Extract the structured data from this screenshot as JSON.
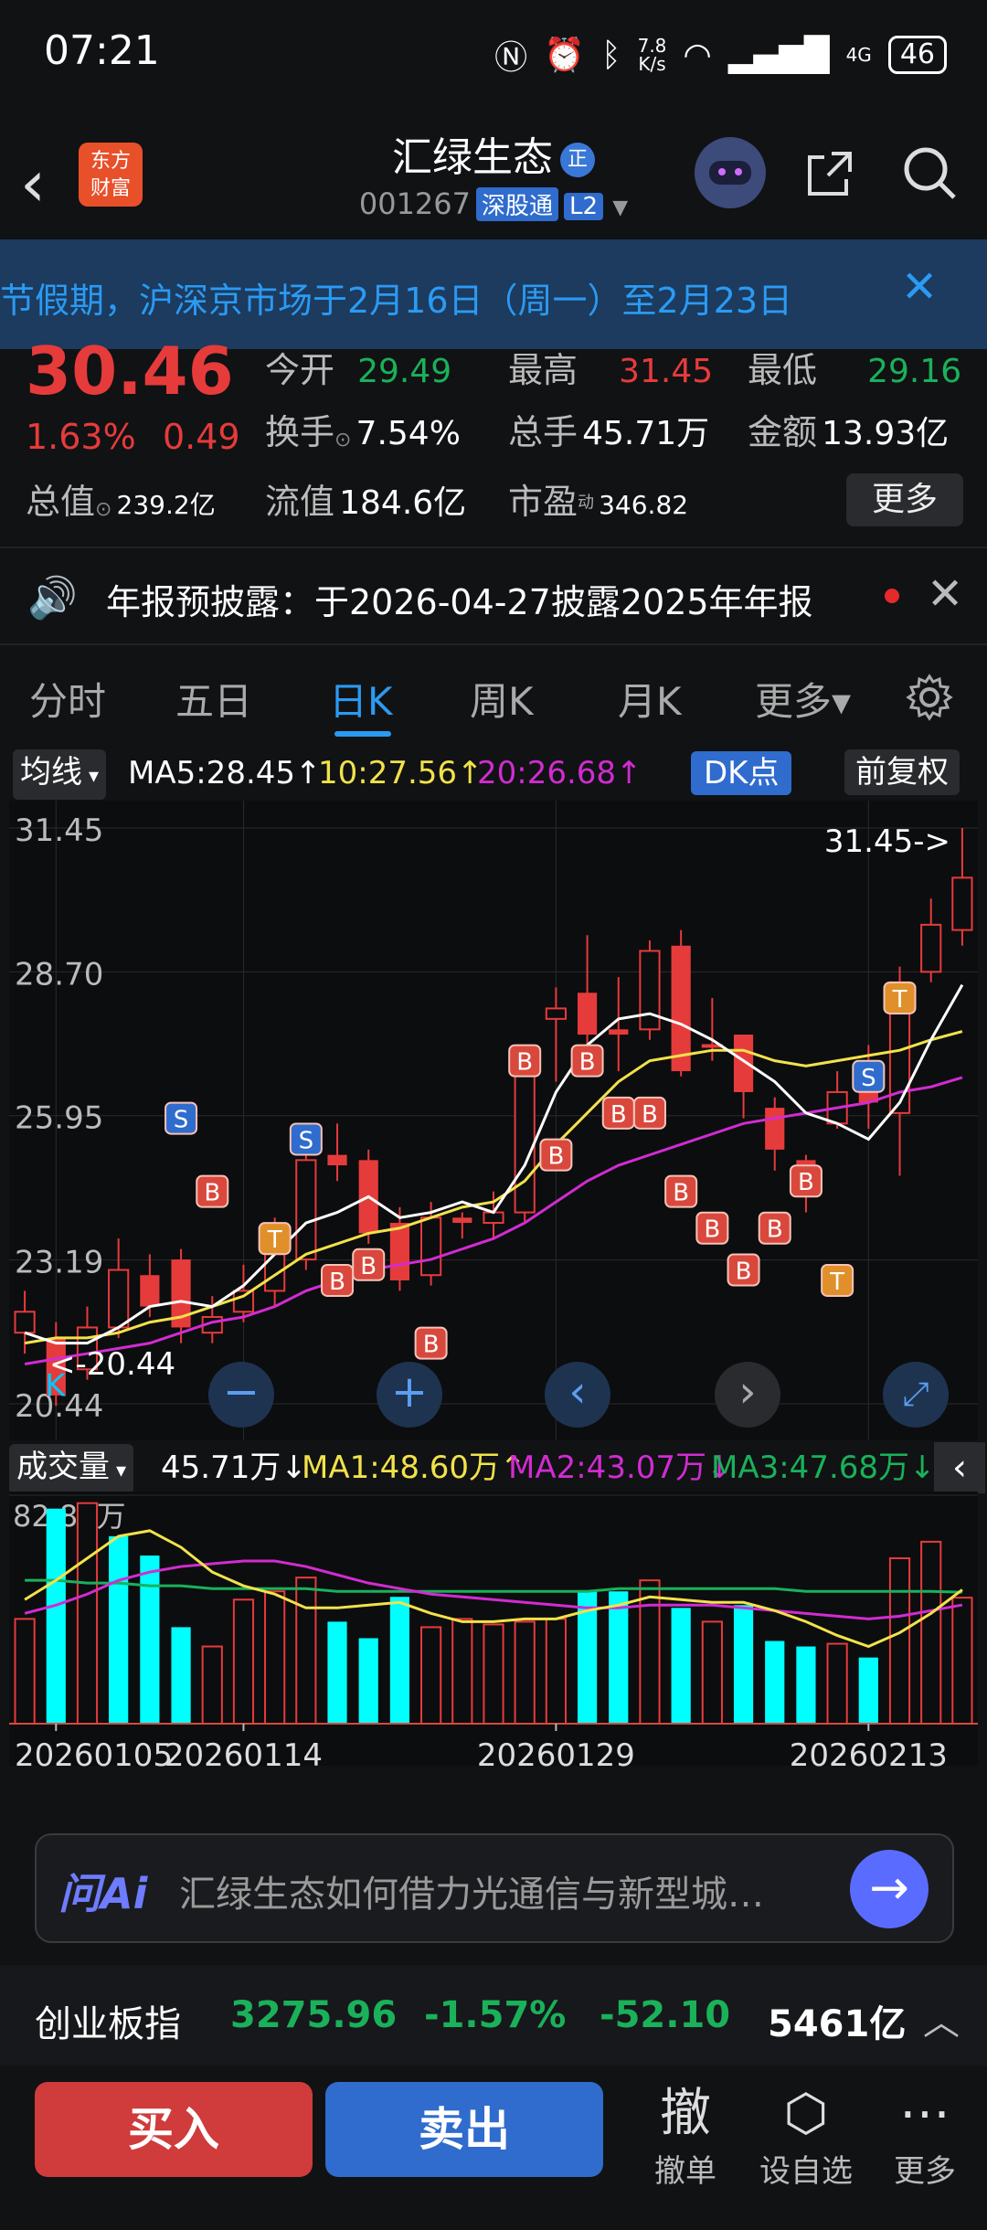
{
  "status_bar": {
    "time": "07:21",
    "speed_top": "7.8",
    "speed_bottom": "K/s",
    "network": "4G",
    "battery": "46"
  },
  "header": {
    "title": "汇绿生态",
    "badge": "正",
    "code": "001267",
    "tag1": "深股通",
    "tag2": "L2",
    "logo_line1": "东方",
    "logo_line2": "财富"
  },
  "notice": {
    "text": "节假期，沪深京市场于2月16日（周一）至2月23日",
    "close": "✕"
  },
  "quote": {
    "price": "30.46",
    "pct": "1.63%",
    "change": "0.49",
    "row1": [
      {
        "label": "今开",
        "value": "29.49",
        "color": "green"
      },
      {
        "label": "最高",
        "value": "31.45",
        "color": "red"
      },
      {
        "label": "最低",
        "value": "29.16",
        "color": "green"
      }
    ],
    "turnover_label": "换手",
    "turnover": "7.54%",
    "volume_label": "总手",
    "volume": "45.71万",
    "amount_label": "金额",
    "amount": "13.93亿",
    "mcap_label": "总值",
    "mcap": "239.2亿",
    "float_label": "流值",
    "float": "184.6亿",
    "pe_label": "市盈",
    "pe_sup": "动",
    "pe": "346.82",
    "more": "更多"
  },
  "announce": {
    "text": "年报预披露：于2026-04-27披露2025年年报",
    "close": "✕"
  },
  "tabs": [
    {
      "label": "分时"
    },
    {
      "label": "五日"
    },
    {
      "label": "日K",
      "active": true
    },
    {
      "label": "周K"
    },
    {
      "label": "月K"
    },
    {
      "label": "更多▾"
    }
  ],
  "chart_bar": {
    "selector": "均线",
    "ma5": "MA5:28.45↑",
    "ma10": "10:27.56↑",
    "ma20": "20:26.68↑",
    "dk": "DK点",
    "fq": "前复权"
  },
  "volume_bar": {
    "selector": "成交量",
    "vol": "45.71万↓",
    "ma1": "MA1:48.60万↑",
    "ma2": "MA2:43.07万↓",
    "ma3": "MA3:47.68万↓",
    "vmax": "82.88万"
  },
  "chart_data": {
    "type": "candlestick",
    "ylim": [
      20.44,
      31.45
    ],
    "yticks": [
      31.45,
      28.7,
      25.95,
      23.19,
      20.44
    ],
    "high_label": "31.45->",
    "low_label": "<-20.44",
    "xticks": [
      {
        "i": 1,
        "label": "20260105"
      },
      {
        "i": 7,
        "label": "20260114"
      },
      {
        "i": 17,
        "label": "20260129"
      },
      {
        "i": 27,
        "label": "20260213"
      }
    ],
    "candles": [
      [
        21.8,
        22.2,
        21.4,
        22.6
      ],
      [
        21.7,
        20.6,
        20.4,
        22.0
      ],
      [
        21.1,
        21.9,
        20.9,
        22.3
      ],
      [
        21.9,
        23.0,
        21.7,
        23.6
      ],
      [
        22.9,
        22.3,
        22.1,
        23.3
      ],
      [
        23.2,
        21.9,
        21.6,
        23.4
      ],
      [
        21.8,
        22.1,
        21.6,
        22.5
      ],
      [
        22.2,
        22.6,
        22.0,
        23.1
      ],
      [
        22.6,
        23.3,
        22.3,
        24.0
      ],
      [
        23.2,
        25.1,
        23.0,
        25.5
      ],
      [
        25.2,
        25.0,
        24.7,
        25.8
      ],
      [
        25.1,
        23.7,
        23.5,
        25.3
      ],
      [
        23.9,
        22.8,
        22.6,
        24.2
      ],
      [
        22.9,
        24.0,
        22.7,
        24.3
      ],
      [
        24.0,
        23.9,
        23.6,
        24.1
      ],
      [
        23.9,
        24.1,
        23.6,
        24.5
      ],
      [
        24.1,
        26.8,
        23.9,
        27.3
      ],
      [
        27.8,
        28.0,
        26.6,
        28.4
      ],
      [
        28.3,
        27.5,
        27.3,
        29.4
      ],
      [
        27.6,
        27.5,
        26.8,
        28.6
      ],
      [
        27.6,
        29.1,
        27.4,
        29.3
      ],
      [
        29.2,
        26.8,
        26.7,
        29.5
      ],
      [
        27.3,
        27.3,
        27.0,
        28.2
      ],
      [
        27.5,
        26.4,
        25.9,
        27.5
      ],
      [
        26.1,
        25.3,
        24.9,
        26.3
      ],
      [
        25.1,
        25.0,
        24.1,
        25.2
      ],
      [
        25.8,
        26.4,
        25.7,
        26.8
      ],
      [
        26.8,
        26.2,
        25.7,
        27.3
      ],
      [
        26.0,
        28.5,
        24.8,
        28.8
      ],
      [
        28.7,
        29.6,
        28.5,
        30.1
      ],
      [
        29.5,
        30.5,
        29.2,
        31.45
      ]
    ],
    "ma5": [
      21.8,
      21.6,
      21.6,
      21.9,
      22.3,
      22.4,
      22.3,
      22.7,
      23.3,
      23.9,
      24.1,
      24.4,
      24.0,
      24.1,
      24.3,
      24.1,
      25.0,
      26.4,
      27.3,
      27.8,
      27.9,
      27.7,
      27.4,
      27.0,
      26.6,
      26.0,
      25.8,
      25.5,
      26.2,
      27.4,
      28.45
    ],
    "ma10": [
      21.6,
      21.7,
      21.7,
      21.8,
      22.0,
      22.1,
      22.3,
      22.5,
      22.9,
      23.3,
      23.5,
      23.7,
      23.8,
      24.0,
      24.2,
      24.3,
      24.7,
      25.4,
      26.0,
      26.6,
      27.0,
      27.1,
      27.2,
      27.2,
      27.0,
      26.9,
      27.0,
      27.1,
      27.2,
      27.4,
      27.56
    ],
    "ma20": [
      21.2,
      21.3,
      21.4,
      21.5,
      21.6,
      21.8,
      22.0,
      22.1,
      22.3,
      22.6,
      22.8,
      23.0,
      23.1,
      23.2,
      23.4,
      23.6,
      23.9,
      24.3,
      24.7,
      25.0,
      25.2,
      25.4,
      25.6,
      25.8,
      25.9,
      26.0,
      26.1,
      26.2,
      26.4,
      26.5,
      26.68
    ],
    "markers": [
      {
        "i": 6,
        "y": 24.5,
        "t": "B"
      },
      {
        "i": 8,
        "y": 23.6,
        "t": "T"
      },
      {
        "i": 10,
        "y": 22.8,
        "t": "B"
      },
      {
        "i": 11,
        "y": 23.1,
        "t": "B"
      },
      {
        "i": 13,
        "y": 21.6,
        "t": "B"
      },
      {
        "i": 16,
        "y": 27.0,
        "t": "B"
      },
      {
        "i": 17,
        "y": 25.2,
        "t": "B"
      },
      {
        "i": 18,
        "y": 27.0,
        "t": "B"
      },
      {
        "i": 19,
        "y": 26.0,
        "t": "B"
      },
      {
        "i": 20,
        "y": 26.0,
        "t": "B"
      },
      {
        "i": 21,
        "y": 24.5,
        "t": "B"
      },
      {
        "i": 22,
        "y": 23.8,
        "t": "B"
      },
      {
        "i": 23,
        "y": 23.0,
        "t": "B"
      },
      {
        "i": 24,
        "y": 23.8,
        "t": "B"
      },
      {
        "i": 25,
        "y": 24.7,
        "t": "B"
      },
      {
        "i": 26,
        "y": 22.8,
        "t": "T"
      },
      {
        "i": 27,
        "y": 26.7,
        "t": "S"
      },
      {
        "i": 28,
        "y": 28.2,
        "t": "T"
      },
      {
        "i": 5,
        "y": 25.9,
        "t": "S"
      },
      {
        "i": 9,
        "y": 25.5,
        "t": "S"
      },
      {
        "i": 1,
        "y": 20.8,
        "t": "K"
      }
    ],
    "volume": {
      "ylim": [
        0,
        82.88
      ],
      "values": [
        38,
        78,
        80,
        68,
        61,
        35,
        28,
        45,
        48,
        53,
        37,
        31,
        46,
        35,
        38,
        36,
        37,
        38,
        48,
        48,
        52,
        42,
        37,
        43,
        30,
        28,
        29,
        24,
        60,
        66,
        45.71
      ],
      "up": [
        true,
        false,
        true,
        false,
        false,
        false,
        true,
        true,
        true,
        true,
        false,
        false,
        false,
        true,
        true,
        true,
        true,
        true,
        false,
        false,
        true,
        false,
        true,
        false,
        false,
        false,
        true,
        false,
        true,
        true,
        true
      ],
      "ma1": [
        45,
        52,
        60,
        68,
        70,
        64,
        55,
        50,
        47,
        42,
        42,
        43,
        44,
        40,
        37,
        37,
        38,
        38,
        41,
        43,
        46,
        45,
        44,
        44,
        41,
        37,
        32,
        28,
        33,
        40,
        48.6
      ],
      "ma2": [
        40,
        43,
        47,
        52,
        55,
        57,
        58,
        59,
        59,
        57,
        54,
        51,
        49,
        47,
        46,
        45,
        44,
        43,
        42,
        42,
        43,
        43,
        43,
        42,
        41,
        40,
        39,
        38,
        39,
        41,
        43.07
      ],
      "ma3": [
        52,
        52,
        51,
        51,
        50,
        50,
        49,
        49,
        49,
        49,
        48,
        48,
        48,
        48,
        48,
        48,
        48,
        48,
        48,
        49,
        49,
        49,
        49,
        49,
        49,
        48,
        48,
        48,
        48,
        48,
        47.68
      ]
    }
  },
  "ai": {
    "logo": "问Ai",
    "question": "汇绿生态如何借力光通信与新型城…",
    "go": "→"
  },
  "index_bar": {
    "name": "创业板指",
    "value": "3275.96",
    "pct": "-1.57%",
    "change": "-52.10",
    "amount": "5461亿",
    "up": "︿"
  },
  "bottom": {
    "buy": "买入",
    "sell": "卖出",
    "cancel_icon": "撤",
    "cancel": "撤单",
    "watch": "设自选",
    "more": "更多"
  },
  "colors": {
    "up": "#e63b3b",
    "down": "#1ab15a",
    "accent": "#2b9af3",
    "ma5": "#ffffff",
    "ma10": "#f2e24a",
    "ma20": "#d12cd1",
    "vol_down": "#00ffff"
  }
}
